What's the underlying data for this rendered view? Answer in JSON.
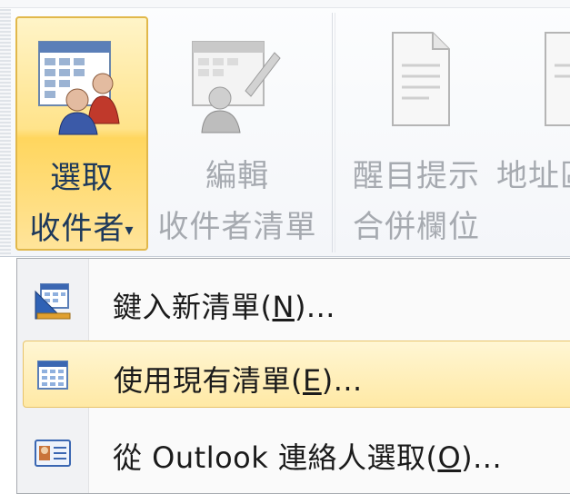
{
  "ribbon": {
    "buttons": [
      {
        "id": "select-recipients",
        "line1": "選取",
        "line2": "收件者",
        "dropdown_arrow": "▾",
        "state": "selected"
      },
      {
        "id": "edit-recipient-list",
        "line1": "編輯",
        "line2": "收件者清單",
        "state": "disabled"
      },
      {
        "id": "highlight-merge-fields",
        "line1": "醒目提示",
        "line2": "合併欄位",
        "state": "disabled"
      },
      {
        "id": "address-block",
        "line1": "地址區",
        "state": "disabled"
      }
    ]
  },
  "menu": {
    "items": [
      {
        "label_prefix": "鍵入新清單(",
        "accel": "N",
        "label_suffix": ")...",
        "icon": "new-list-icon",
        "hover": false
      },
      {
        "label_prefix": "使用現有清單(",
        "accel": "E",
        "label_suffix": ")...",
        "icon": "existing-list-icon",
        "hover": true
      },
      {
        "label_prefix": "從 Outlook 連絡人選取(",
        "accel": "O",
        "label_suffix": ")...",
        "icon": "outlook-contacts-icon",
        "hover": false
      }
    ]
  },
  "colors": {
    "selected_fill": "#ffe38a",
    "selected_border": "#e1b84b",
    "selected_text": "#1e395b",
    "disabled_text": "#a6aab0",
    "hover_fill": "#ffe9a5"
  }
}
